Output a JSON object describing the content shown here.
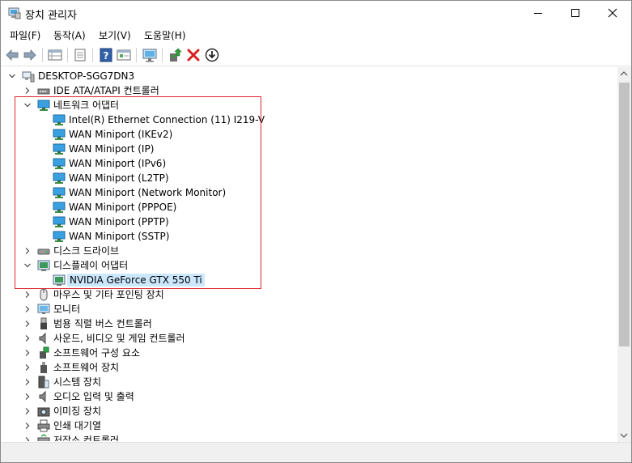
{
  "window": {
    "title": "장치 관리자",
    "controls": {
      "minimize": "minimize",
      "maximize": "maximize",
      "close": "close"
    }
  },
  "menu": [
    {
      "label": "파일(F)"
    },
    {
      "label": "동작(A)"
    },
    {
      "label": "보기(V)"
    },
    {
      "label": "도움말(H)"
    }
  ],
  "toolbar": {
    "icons": [
      "back-icon",
      "forward-icon",
      "properties-grid-icon",
      "print-icon",
      "help-icon",
      "show-hidden-icon",
      "monitor-scan-icon",
      "update-driver-icon",
      "uninstall-icon",
      "download-icon"
    ]
  },
  "tree": {
    "root": "DESKTOP-SGG7DN3",
    "items": [
      {
        "label": "IDE ATA/ATAPI 컨트롤러",
        "level": 1,
        "expanded": false
      },
      {
        "label": "네트워크 어댑터",
        "level": 1,
        "expanded": true
      },
      {
        "label": "Intel(R) Ethernet Connection (11) I219-V",
        "level": 2
      },
      {
        "label": "WAN Miniport (IKEv2)",
        "level": 2
      },
      {
        "label": "WAN Miniport (IP)",
        "level": 2
      },
      {
        "label": "WAN Miniport (IPv6)",
        "level": 2
      },
      {
        "label": "WAN Miniport (L2TP)",
        "level": 2
      },
      {
        "label": "WAN Miniport (Network Monitor)",
        "level": 2
      },
      {
        "label": "WAN Miniport (PPPOE)",
        "level": 2
      },
      {
        "label": "WAN Miniport (PPTP)",
        "level": 2
      },
      {
        "label": "WAN Miniport (SSTP)",
        "level": 2
      },
      {
        "label": "디스크 드라이브",
        "level": 1,
        "expanded": false
      },
      {
        "label": "디스플레이 어댑터",
        "level": 1,
        "expanded": true
      },
      {
        "label": "NVIDIA GeForce GTX 550 Ti",
        "level": 2,
        "selected": true
      },
      {
        "label": "마우스 및 기타 포인팅 장치",
        "level": 1,
        "expanded": false
      },
      {
        "label": "모니터",
        "level": 1,
        "expanded": false
      },
      {
        "label": "범용 직렬 버스 컨트롤러",
        "level": 1,
        "expanded": false
      },
      {
        "label": "사운드, 비디오 및 게임 컨트롤러",
        "level": 1,
        "expanded": false
      },
      {
        "label": "소프트웨어 구성 요소",
        "level": 1,
        "expanded": false
      },
      {
        "label": "소프트웨어 장치",
        "level": 1,
        "expanded": false
      },
      {
        "label": "시스템 장치",
        "level": 1,
        "expanded": false
      },
      {
        "label": "오디오 입력 및 출력",
        "level": 1,
        "expanded": false
      },
      {
        "label": "이미징 장치",
        "level": 1,
        "expanded": false
      },
      {
        "label": "인쇄 대기열",
        "level": 1,
        "expanded": false
      },
      {
        "label": "저장소 컨트롤러",
        "level": 1,
        "expanded": false
      }
    ]
  },
  "colors": {
    "highlight_box": "#e0262e",
    "selection": "#cce8ff"
  }
}
